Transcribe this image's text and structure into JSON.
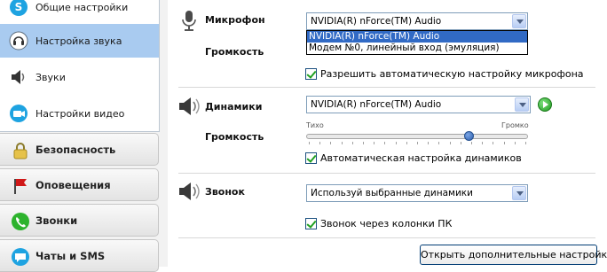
{
  "sidebar": {
    "sub_items": [
      {
        "label": "Общие настройки",
        "icon": "skype-icon"
      },
      {
        "label": "Настройка звука",
        "icon": "headset-icon",
        "active": true
      },
      {
        "label": "Звуки",
        "icon": "speaker-icon"
      },
      {
        "label": "Настройки видео",
        "icon": "webcam-icon"
      }
    ],
    "categories": [
      {
        "label": "Безопасность",
        "icon": "lock-icon"
      },
      {
        "label": "Оповещения",
        "icon": "flag-icon"
      },
      {
        "label": "Звонки",
        "icon": "phone-icon"
      },
      {
        "label": "Чаты и SMS",
        "icon": "chat-icon"
      }
    ]
  },
  "microphone": {
    "label": "Микрофон",
    "selected": "NVIDIA(R) nForce(TM) Audio",
    "options": [
      "NVIDIA(R) nForce(TM) Audio",
      "Модем №0, линейный вход (эмуляция)"
    ],
    "volume_label": "Громкость",
    "auto_adjust_label": "Разрешить автоматическую настройку микрофона"
  },
  "speakers": {
    "label": "Динамики",
    "selected": "NVIDIA(R) nForce(TM) Audio",
    "volume_label": "Громкость",
    "slider_min_label": "Тихо",
    "slider_max_label": "Громко",
    "volume_level": 0.73,
    "auto_adjust_label": "Автоматическая настройка динамиков"
  },
  "ringer": {
    "label": "Звонок",
    "selected": "Используй выбранные динамики",
    "pc_speaker_label": "Звонок через колонки ПК"
  },
  "advanced_button": "Открыть дополнительные настройки",
  "colors": {
    "active_item": "#a9cbf0",
    "dropdown_highlight": "#316ac5",
    "play_green": "#1f9a1f"
  }
}
